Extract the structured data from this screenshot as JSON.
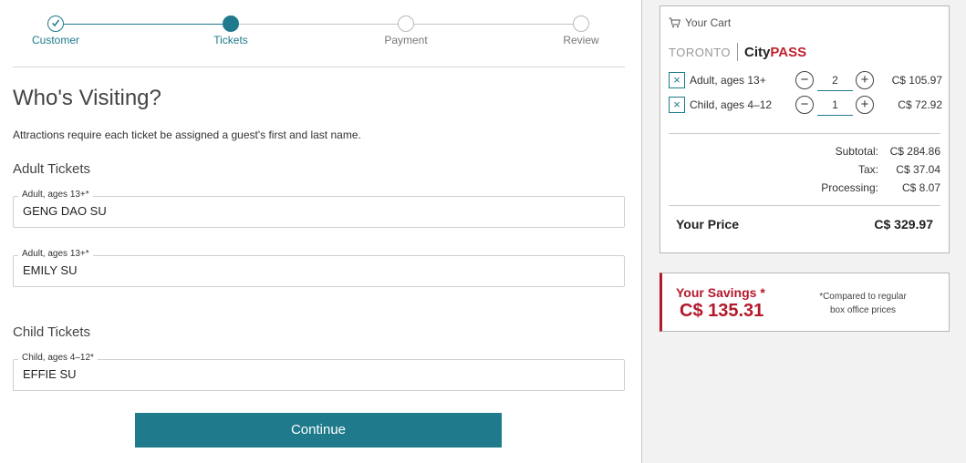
{
  "stepper": {
    "steps": [
      {
        "label": "Customer",
        "state": "done"
      },
      {
        "label": "Tickets",
        "state": "current"
      },
      {
        "label": "Payment",
        "state": "todo"
      },
      {
        "label": "Review",
        "state": "todo"
      }
    ]
  },
  "main": {
    "title": "Who's Visiting?",
    "intro": "Attractions require each ticket be assigned a guest's first and last name.",
    "adult_section": "Adult Tickets",
    "child_section": "Child Tickets",
    "fields": [
      {
        "label": "Adult, ages 13+*",
        "value": "GENG DAO SU"
      },
      {
        "label": "Adult, ages 13+*",
        "value": "EMILY SU"
      },
      {
        "label": "Child, ages 4–12*",
        "value": "EFFIE SU"
      }
    ],
    "continue_label": "Continue"
  },
  "cart": {
    "title": "Your Cart",
    "brand_city": "TORONTO",
    "brand_name_a": "City",
    "brand_name_b": "PASS",
    "items": [
      {
        "remove": "×",
        "name": "Adult, ages 13+",
        "minus": "−",
        "qty": "2",
        "plus": "+",
        "price": "C$ 105.97"
      },
      {
        "remove": "×",
        "name": "Child, ages 4–12",
        "minus": "−",
        "qty": "1",
        "plus": "+",
        "price": "C$ 72.92"
      }
    ],
    "subtotal_label": "Subtotal:",
    "subtotal_value": "C$ 284.86",
    "tax_label": "Tax:",
    "tax_value": "C$ 37.04",
    "processing_label": "Processing:",
    "processing_value": "C$ 8.07",
    "total_label": "Your Price",
    "total_value": "C$ 329.97"
  },
  "savings": {
    "label": "Your Savings *",
    "value": "C$ 135.31",
    "note_line1": "*Compared to regular",
    "note_line2": "box office prices"
  },
  "colors": {
    "accent": "#1f7a8c",
    "savings_red": "#b3192c",
    "brand_red": "#c0202e",
    "sidebar_bg": "#f2f2f2"
  },
  "icons": {
    "cart": "shopping-cart-icon",
    "completed_step": "check-icon"
  }
}
